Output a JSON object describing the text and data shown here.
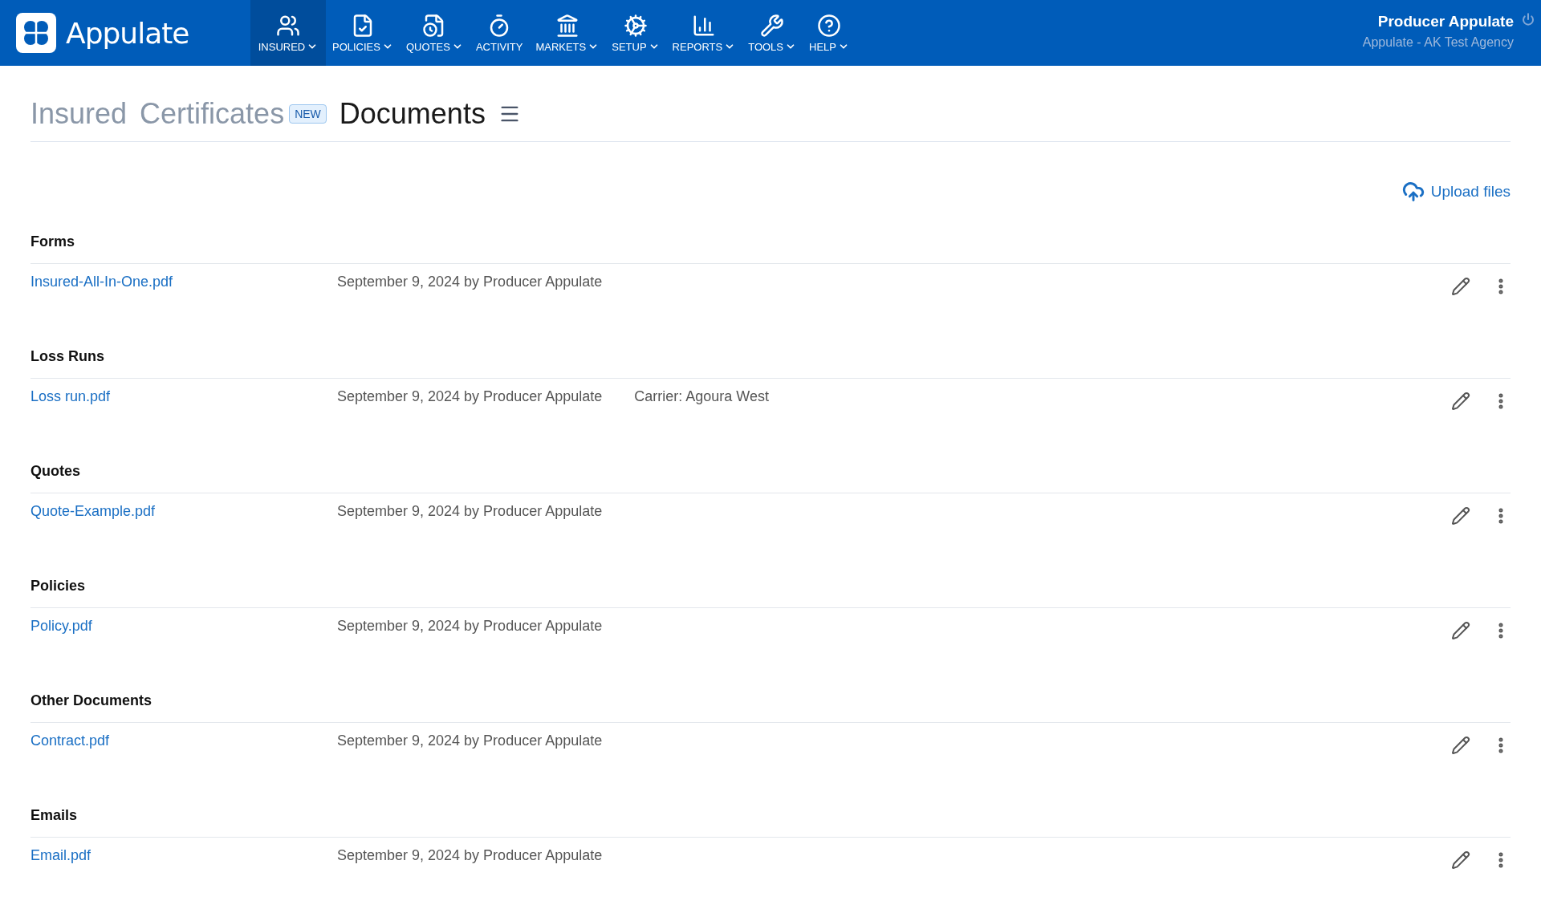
{
  "header": {
    "logo": "Appulate",
    "nav": [
      {
        "label": "INSURED",
        "dropdown": true,
        "selected": true
      },
      {
        "label": "POLICIES",
        "dropdown": true,
        "selected": false
      },
      {
        "label": "QUOTES",
        "dropdown": true,
        "selected": false
      },
      {
        "label": "ACTIVITY",
        "dropdown": false,
        "selected": false
      },
      {
        "label": "MARKETS",
        "dropdown": true,
        "selected": false
      },
      {
        "label": "SETUP",
        "dropdown": true,
        "selected": false
      },
      {
        "label": "REPORTS",
        "dropdown": true,
        "selected": false
      },
      {
        "label": "TOOLS",
        "dropdown": true,
        "selected": false
      },
      {
        "label": "HELP",
        "dropdown": true,
        "selected": false
      }
    ],
    "user": {
      "name": "Producer Appulate",
      "agency": "Appulate - AK Test Agency"
    }
  },
  "tabs": [
    {
      "label": "Insured",
      "selected": false
    },
    {
      "label": "Certificates",
      "selected": false,
      "badge": "NEW"
    },
    {
      "label": "Documents",
      "selected": true
    }
  ],
  "upload": "Upload files",
  "sections": [
    {
      "title": "Forms",
      "files": [
        {
          "name": "Insured-All-In-One.pdf",
          "meta": "September 9, 2024 by Producer Appulate"
        }
      ]
    },
    {
      "title": "Loss Runs",
      "files": [
        {
          "name": "Loss run.pdf",
          "meta": "September 9, 2024 by Producer Appulate",
          "extra": "Carrier: Agoura West"
        }
      ]
    },
    {
      "title": "Quotes",
      "files": [
        {
          "name": "Quote-Example.pdf",
          "meta": "September 9, 2024 by Producer Appulate"
        }
      ]
    },
    {
      "title": "Policies",
      "files": [
        {
          "name": "Policy.pdf",
          "meta": "September 9, 2024 by Producer Appulate"
        }
      ]
    },
    {
      "title": "Other Documents",
      "files": [
        {
          "name": "Contract.pdf",
          "meta": "September 9, 2024 by Producer Appulate"
        }
      ]
    },
    {
      "title": "Emails",
      "files": [
        {
          "name": "Email.pdf",
          "meta": "September 9, 2024 by Producer Appulate"
        }
      ]
    }
  ]
}
